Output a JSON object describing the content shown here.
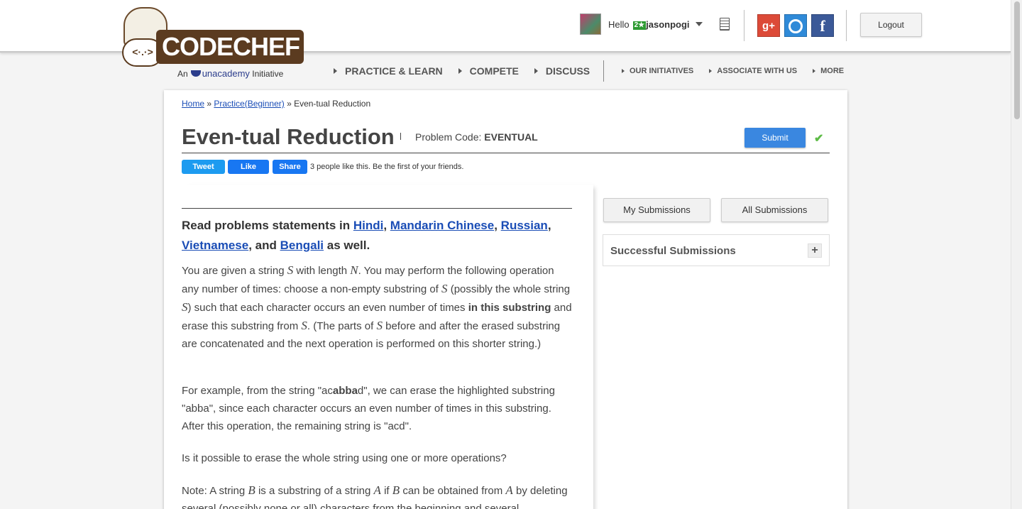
{
  "header": {
    "logo_text": "CODECHEF",
    "logo_face": "<·.·>",
    "logo_an": "An",
    "logo_brand": "unacademy",
    "logo_initiative": "Initiative",
    "greeting": "Hello",
    "rank_badge": "2★",
    "username": "jasonpogi",
    "logout_label": "Logout",
    "gplus_label": "g+",
    "fb_label": "f"
  },
  "nav": {
    "main": [
      "PRACTICE & LEARN",
      "COMPETE",
      "DISCUSS"
    ],
    "secondary": [
      "OUR INITIATIVES",
      "ASSOCIATE WITH US",
      "MORE"
    ]
  },
  "breadcrumb": {
    "home": "Home",
    "sep1": " » ",
    "practice": "Practice(Beginner)",
    "sep2": " » ",
    "current": "Even-tual Reduction"
  },
  "problem": {
    "title": "Even-tual Reduction",
    "code_label": "Problem Code: ",
    "code": "EVENTUAL",
    "submit_label": "Submit",
    "check_mark": "✔"
  },
  "share": {
    "tweet_label": "Tweet",
    "like_label": "Like",
    "share_label": "Share",
    "like_text": "3 people like this. Be the first of your friends."
  },
  "statement": {
    "langs_prefix": "Read problems statements in ",
    "hindi": "Hindi",
    "comma1": ", ",
    "mandarin": "Mandarin Chinese",
    "comma2": ", ",
    "russian": "Russian",
    "comma3": ", ",
    "vietnamese": "Vietnamese",
    "and": ", and ",
    "bengali": "Bengali",
    "langs_suffix": " as well.",
    "p1_a": "You are given a string ",
    "var_S": "S",
    "p1_b": " with length ",
    "var_N": "N",
    "p1_c": ". You may perform the following operation any number of times: choose a non-empty substring of ",
    "p1_d": " (possibly the whole string ",
    "p1_e": ") such that each character occurs an even number of times ",
    "p1_bold": "in this substring",
    "p1_f": " and erase this substring from ",
    "p1_g": ". (The parts of ",
    "p1_h": " before and after the erased substring are concatenated and the next operation is performed on this shorter string.)",
    "p2_a": "For example, from the string \"ac",
    "p2_bold": "abba",
    "p2_b": "d\", we can erase the highlighted substring \"abba\", since each character occurs an even number of times in this substring. After this operation, the remaining string is \"acd\".",
    "p3": "Is it possible to erase the whole string using one or more operations?",
    "p4_a": "Note: A string ",
    "var_B": "B",
    "p4_b": " is a substring of a string ",
    "var_A": "A",
    "p4_c": " if ",
    "p4_d": " can be obtained from ",
    "p4_e": " by deleting several (possibly none or all) characters from the beginning and several"
  },
  "sidebar": {
    "my_submissions": "My Submissions",
    "all_submissions": "All Submissions",
    "successful_submissions": "Successful Submissions",
    "expand": "+"
  }
}
